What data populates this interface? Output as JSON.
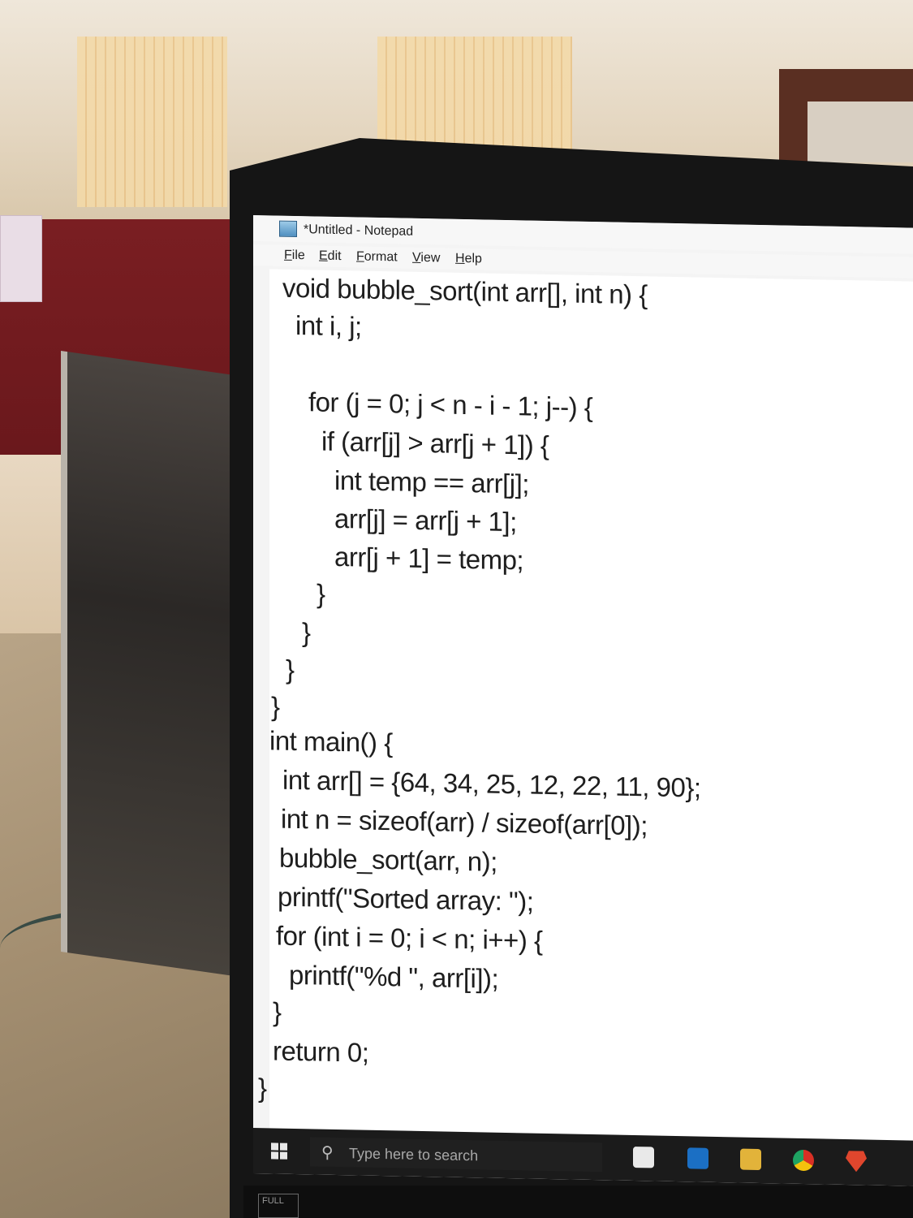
{
  "window": {
    "title": "*Untitled - Notepad",
    "icon": "notepad-icon"
  },
  "menu": {
    "items": [
      "File",
      "Edit",
      "Format",
      "View",
      "Help"
    ]
  },
  "editor": {
    "lines": [
      "void bubble_sort(int arr[], int n) {",
      "int i, j;",
      "for (j = 0; j < n - i - 1; j--) {",
      "if (arr[j] > arr[j + 1]) {",
      "int temp == arr[j];",
      "arr[j] = arr[j + 1];",
      "arr[j + 1] = temp;",
      "}",
      "}",
      "}",
      "}",
      "int main() {",
      "int arr[] = {64, 34, 25, 12, 22, 11, 90};",
      "int n = sizeof(arr) / sizeof(arr[0]);",
      "bubble_sort(arr, n);",
      "printf(\"Sorted array: \");",
      "for (int i = 0; i < n; i++) {",
      "printf(\"%d \", arr[i]);",
      "}",
      "return 0;",
      "}"
    ]
  },
  "taskbar": {
    "start_icon": "windows-logo-icon",
    "search_placeholder": "Type here to search",
    "search_icon": "search-icon",
    "pinned_icons": [
      "store-icon",
      "mail-icon",
      "file-explorer-icon",
      "chrome-icon",
      "brave-icon"
    ]
  },
  "laptop": {
    "badge_text": "FULL"
  }
}
